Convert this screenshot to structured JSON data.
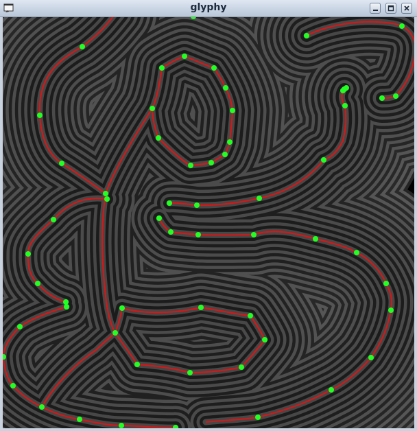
{
  "window": {
    "title": "glyphy",
    "icons": {
      "app": "terminal-window-icon",
      "minimize": "minimize-icon",
      "maximize": "maximize-icon",
      "close": "close-icon"
    }
  },
  "render": {
    "glyph_outline_color": "#e21212",
    "control_point_color": "#22ff22",
    "background_color": "#000000",
    "field_band_color": "#7a7a7a"
  }
}
